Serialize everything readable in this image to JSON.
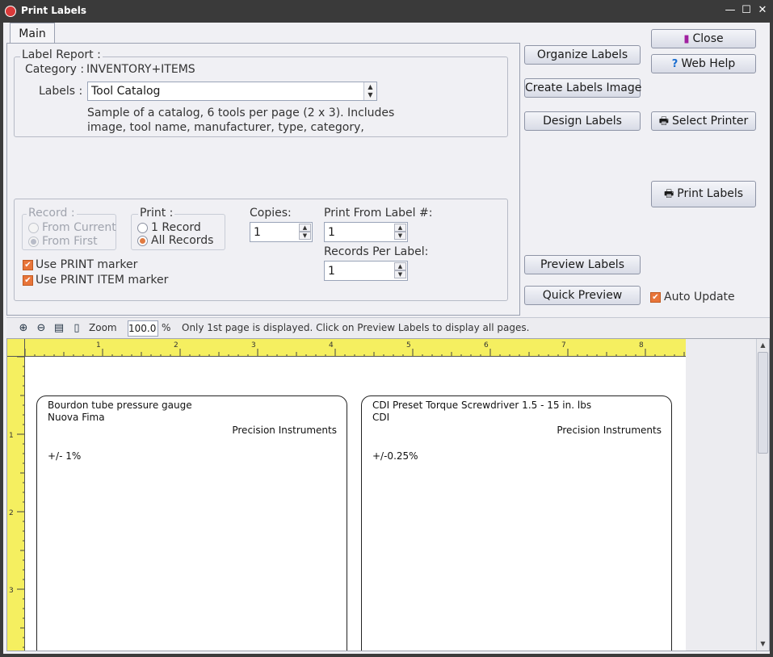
{
  "window": {
    "title": "Print Labels",
    "controls": {
      "minimize": "—",
      "maximize": "☐",
      "close": "✕"
    }
  },
  "tabs": {
    "main": "Main"
  },
  "label_report": {
    "legend": "Label Report :",
    "category_label": "Category :",
    "category_value": "INVENTORY+ITEMS",
    "labels_label": "Labels :",
    "labels_value": "Tool Catalog",
    "description_line1": "Sample of a catalog, 6 tools per page (2 x 3). Includes",
    "description_line2": "image, tool name, manufacturer, type, category,"
  },
  "options": {
    "record_legend": "Record :",
    "from_current": "From Current",
    "from_first": "From First",
    "print_legend": "Print :",
    "one_record": "1 Record",
    "all_records": "All Records",
    "copies_label": "Copies:",
    "copies_value": "1",
    "print_from_label": "Print From Label #:",
    "print_from_value": "1",
    "records_per_label": "Records Per Label:",
    "records_per_value": "1",
    "use_print_marker": "Use PRINT marker",
    "use_print_item_marker": "Use PRINT ITEM marker"
  },
  "buttons": {
    "organize_labels": "Organize Labels",
    "create_labels_image": "Create Labels Image",
    "design_labels": "Design Labels",
    "close": "Close",
    "web_help": "Web Help",
    "select_printer": "Select Printer",
    "print_labels": "Print Labels",
    "preview_labels": "Preview Labels",
    "quick_preview": "Quick Preview",
    "auto_update": "Auto Update"
  },
  "toolbar": {
    "zoom_label": "Zoom",
    "zoom_value": "100.0",
    "zoom_unit": "%",
    "info": "Only 1st page is displayed. Click on Preview Labels to display all pages."
  },
  "ruler": {
    "h_numbers": [
      "1",
      "2",
      "3",
      "4",
      "5",
      "6",
      "7",
      "8"
    ],
    "v_numbers": [
      "1",
      "2",
      "3"
    ]
  },
  "labels": [
    {
      "line1": "Bourdon tube pressure gauge",
      "line2": "Nuova Fima",
      "line3": "Precision Instruments",
      "line4": "+/- 1%"
    },
    {
      "line1": "CDI Preset Torque Screwdriver 1.5 - 15 in. lbs",
      "line2": "CDI",
      "line3": "Precision Instruments",
      "line4": "+/-0.25%"
    }
  ]
}
